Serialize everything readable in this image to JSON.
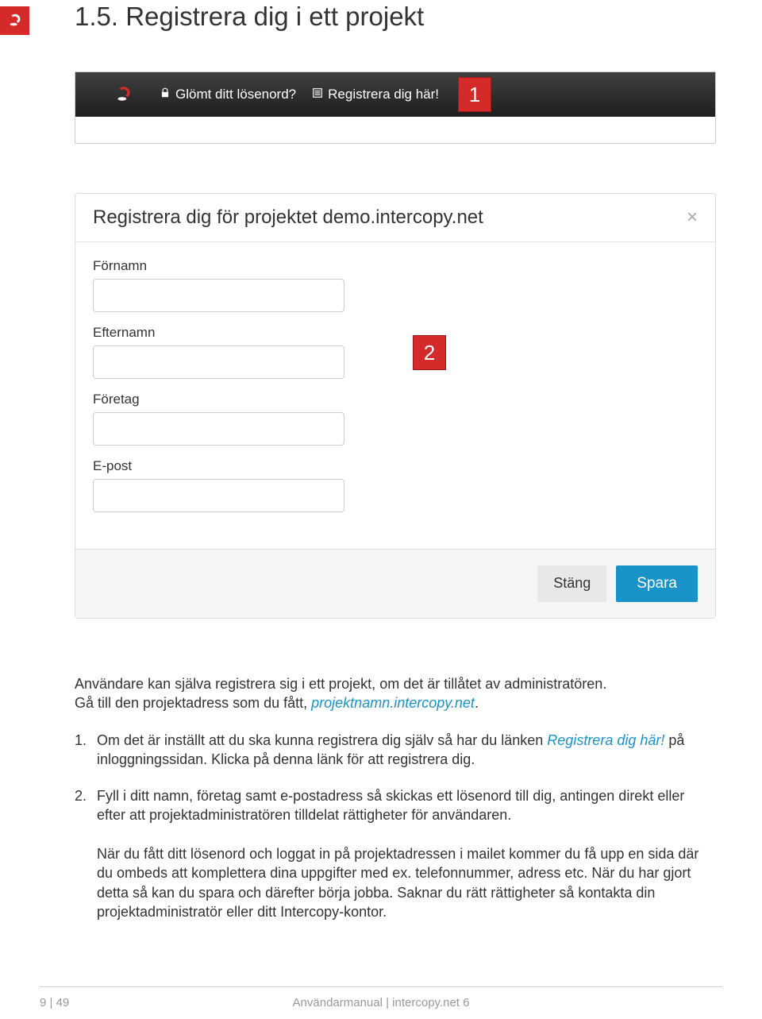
{
  "section_title": "1.5. Registrera dig i ett projekt",
  "topbar": {
    "forgot_password": "Glömt ditt lösenord?",
    "register_here": "Registrera dig här!",
    "marker": "1"
  },
  "dialog": {
    "title": "Registrera dig för projektet demo.intercopy.net",
    "close_symbol": "×",
    "fields": {
      "firstname_label": "Förnamn",
      "lastname_label": "Efternamn",
      "company_label": "Företag",
      "email_label": "E-post"
    },
    "marker": "2",
    "close_button": "Stäng",
    "save_button": "Spara"
  },
  "body": {
    "intro_line1": "Användare kan själva registrera sig i ett projekt, om det är tillåtet av administratören.",
    "intro_line2_pre": "Gå till den projektadress som du fått, ",
    "intro_link": "projektnamn.intercopy.net",
    "intro_line2_post": ".",
    "item1_num": "1.",
    "item1_pre": "Om det är inställt att du ska kunna registrera dig själv så har du länken ",
    "item1_link": "Registrera dig här!",
    "item1_post": " på inloggningssidan. Klicka på denna länk för att registrera dig.",
    "item2_num": "2.",
    "item2_p1": "Fyll i ditt namn, företag samt e-postadress så skickas ett lösenord till dig, antingen direkt eller efter att projektadministratören tilldelat rättigheter för användaren.",
    "item2_p2": "När du fått ditt lösenord och loggat in på projektadressen i mailet kommer du få upp en sida där du ombeds att komplettera dina uppgifter med ex. telefonnummer, adress etc. När du har gjort detta så kan du spara och därefter börja jobba. Saknar du rätt rättigheter så kontakta din projektadministratör eller ditt Intercopy-kontor."
  },
  "footer": {
    "page": "9 | 49",
    "center": "Användarmanual  |  intercopy.net 6"
  }
}
